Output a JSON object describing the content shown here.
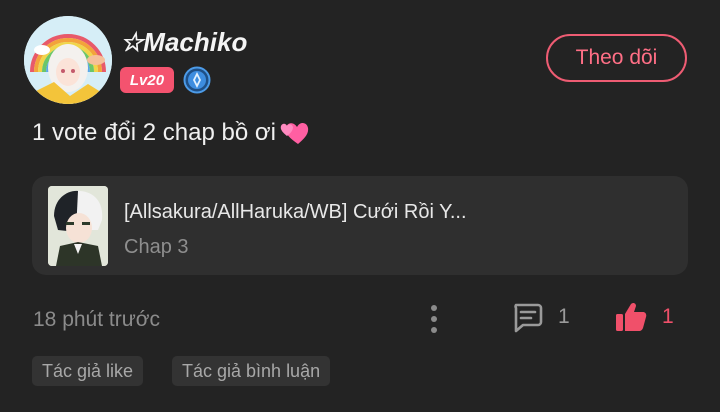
{
  "user": {
    "name": "☆Machiko",
    "level": "Lv20"
  },
  "follow_label": "Theo dõi",
  "comment": {
    "text": "1 vote đổi 2 chap bồ ơi",
    "emoji": "two-hearts-icon"
  },
  "chapter": {
    "title": "[Allsakura/AllHaruka/WB] Cưới Rồi Y...",
    "subtitle": "Chap 3"
  },
  "meta": {
    "time": "18 phút trước",
    "comment_count": "1",
    "like_count": "1"
  },
  "tags": [
    "Tác giả like",
    "Tác giả bình luận"
  ],
  "colors": {
    "background": "#232323",
    "card": "#2f2f2f",
    "accent": "#f0506a",
    "level_badge": "#f4536f",
    "verified": "#3d8de0"
  }
}
